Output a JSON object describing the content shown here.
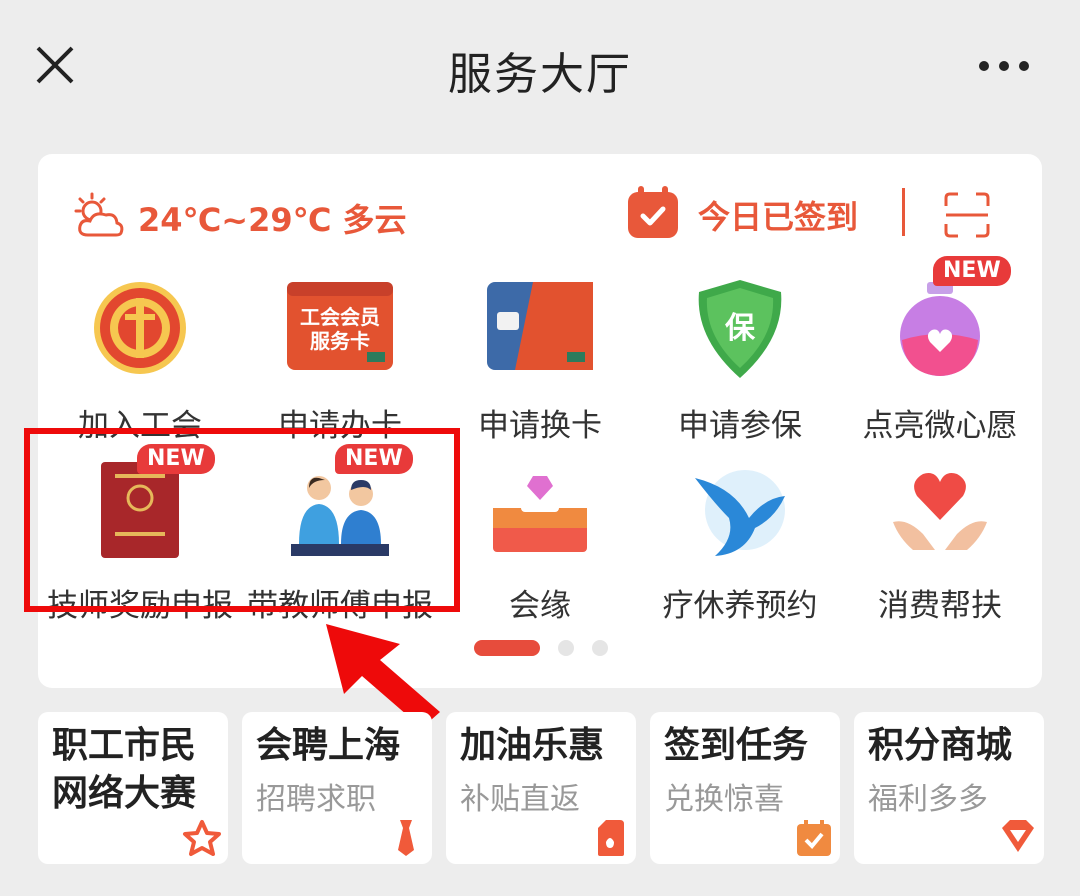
{
  "header": {
    "title": "服务大厅"
  },
  "weather": {
    "text": "24℃~29℃ 多云"
  },
  "signin": {
    "text": "今日已签到"
  },
  "grid": [
    {
      "label": "加入工会",
      "new": false
    },
    {
      "label": "申请办卡",
      "new": false,
      "card_text1": "工会会员",
      "card_text2": "服务卡"
    },
    {
      "label": "申请换卡",
      "new": false
    },
    {
      "label": "申请参保",
      "new": false,
      "shield_char": "保"
    },
    {
      "label": "点亮微心愿",
      "new": true
    },
    {
      "label": "技师奖励申报",
      "new": true
    },
    {
      "label": "带教师傅申报",
      "new": true
    },
    {
      "label": "会缘",
      "new": false
    },
    {
      "label": "疗休养预约",
      "new": false
    },
    {
      "label": "消费帮扶",
      "new": false
    }
  ],
  "new_badge": "NEW",
  "tiles": [
    {
      "title_line1": "职工市民",
      "title_line2": "网络大赛",
      "icon": "star-icon"
    },
    {
      "title_line1": "会聘上海",
      "subtitle": "招聘求职",
      "icon": "tie-icon"
    },
    {
      "title_line1": "加油乐惠",
      "subtitle": "补贴直返",
      "icon": "fuel-icon"
    },
    {
      "title_line1": "签到任务",
      "subtitle": "兑换惊喜",
      "icon": "calendar-check-icon"
    },
    {
      "title_line1": "积分商城",
      "subtitle": "福利多多",
      "icon": "diamond-icon"
    }
  ],
  "colors": {
    "accent": "#e8583a",
    "highlight": "#ee0a0a"
  }
}
